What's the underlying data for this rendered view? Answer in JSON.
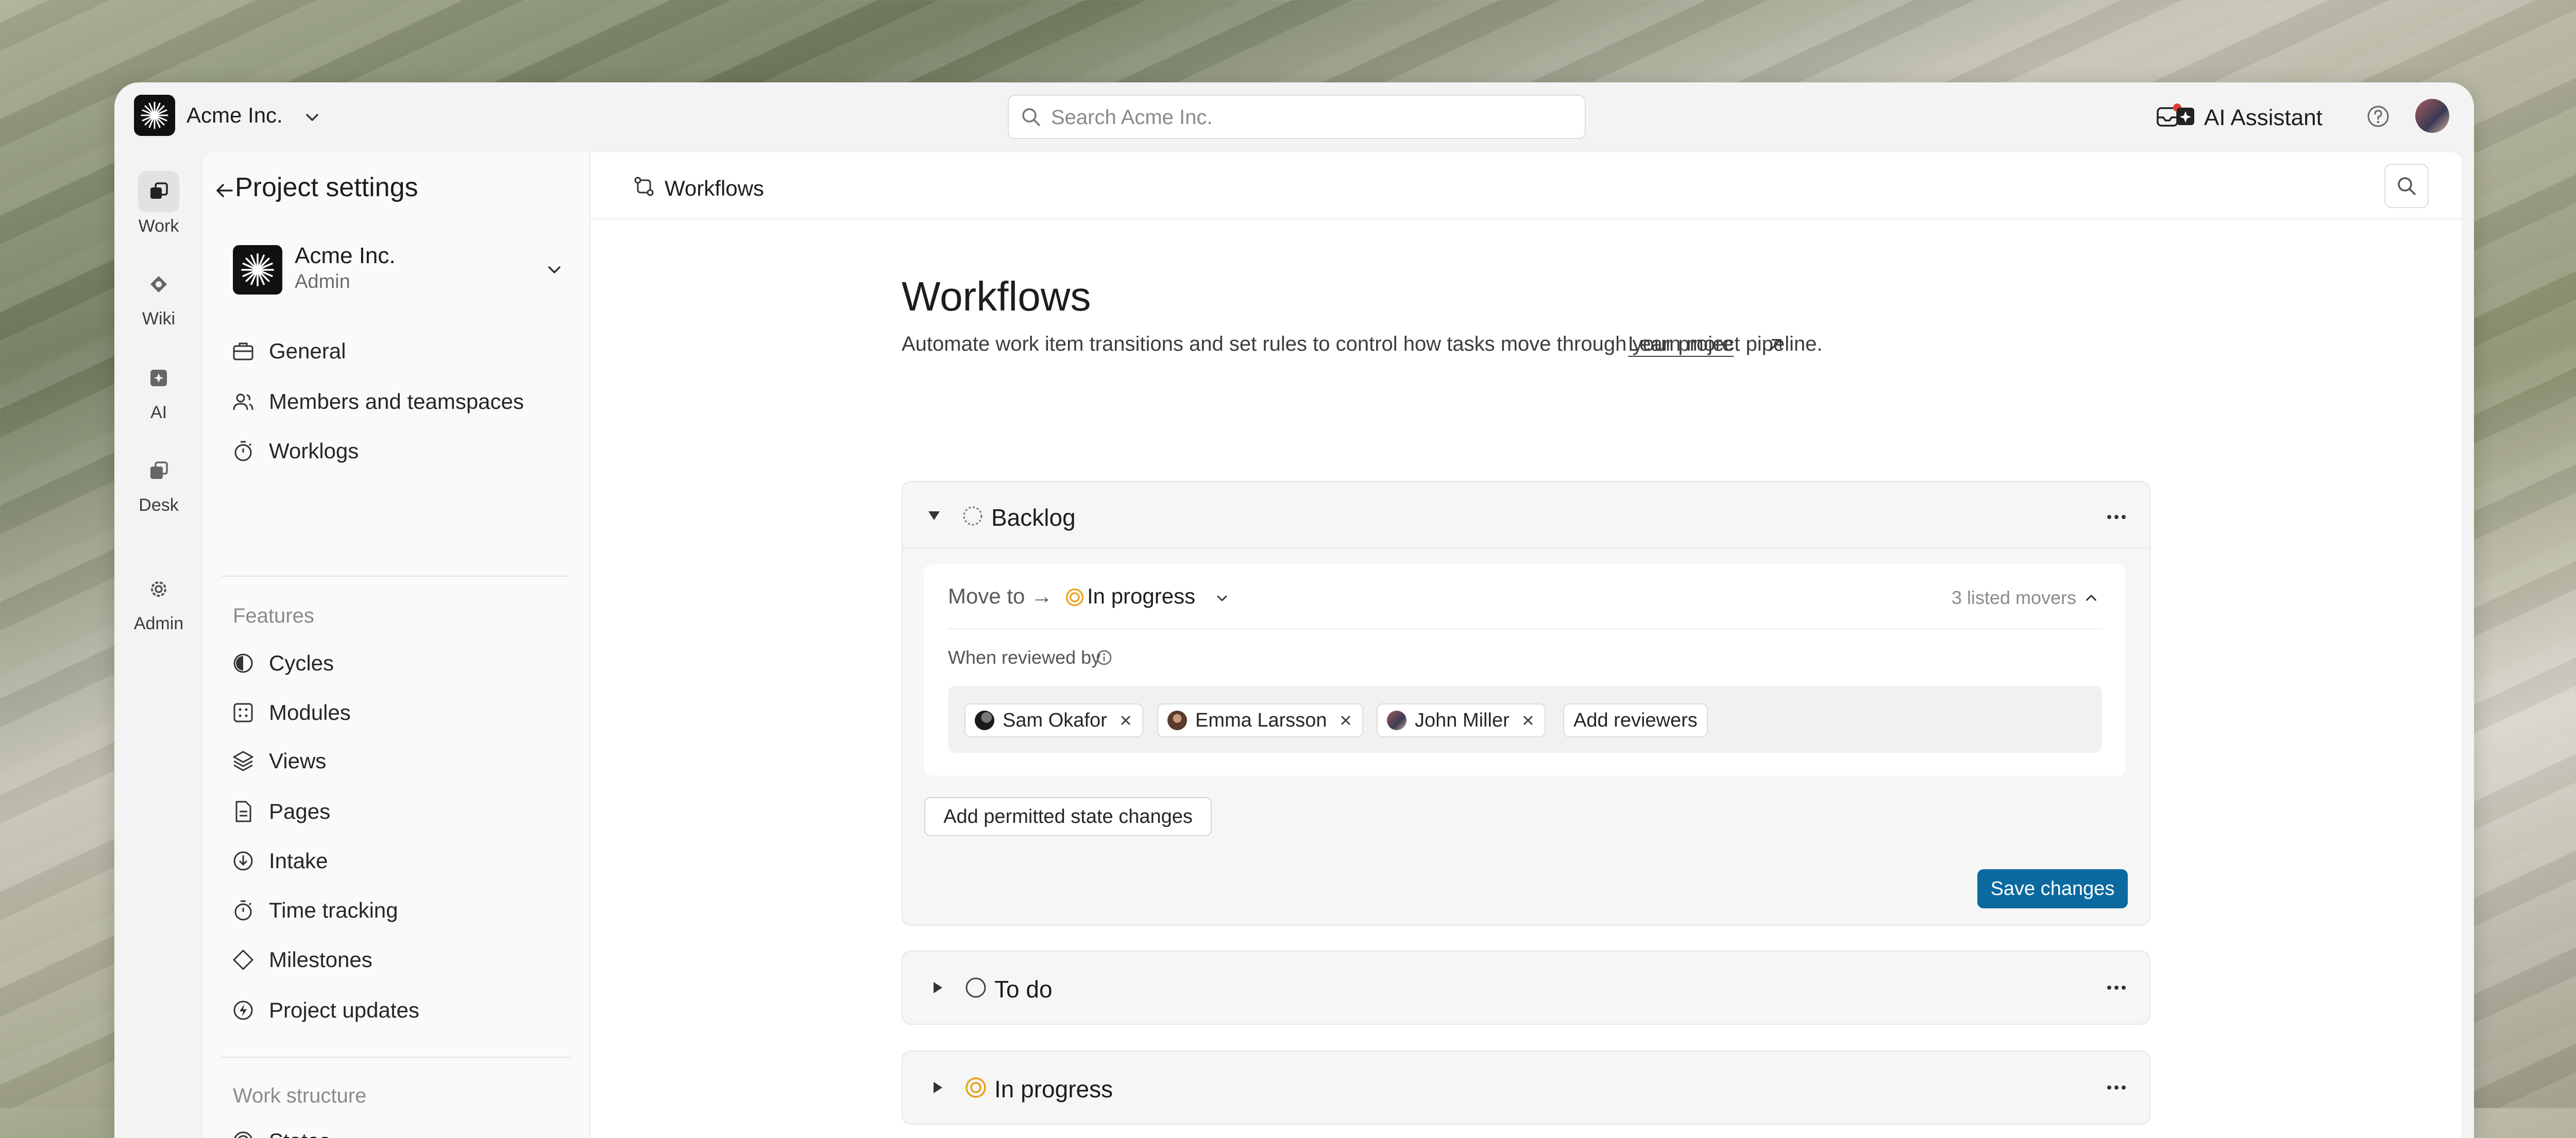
{
  "colors": {
    "accent": "#0a6aa0",
    "in_progress": "#e8a11a",
    "notification": "#e53935"
  },
  "topbar": {
    "workspace_name": "Acme Inc.",
    "search_placeholder": "Search Acme Inc.",
    "ai_assistant_label": "AI Assistant"
  },
  "rail": [
    {
      "label": "Work",
      "icon": "work-icon"
    },
    {
      "label": "Wiki",
      "icon": "wiki-icon"
    },
    {
      "label": "AI",
      "icon": "ai-icon"
    },
    {
      "label": "Desk",
      "icon": "desk-icon"
    },
    {
      "label": "Admin",
      "icon": "gear-icon"
    }
  ],
  "settings": {
    "title": "Project settings",
    "project_name": "Acme Inc.",
    "project_role": "Admin",
    "general_items": [
      {
        "label": "General",
        "icon": "briefcase-icon"
      },
      {
        "label": "Members and teamspaces",
        "icon": "members-icon"
      },
      {
        "label": "Worklogs",
        "icon": "timer-icon"
      }
    ],
    "features_heading": "Features",
    "feature_items": [
      {
        "label": "Cycles",
        "icon": "cycle-icon"
      },
      {
        "label": "Modules",
        "icon": "modules-icon"
      },
      {
        "label": "Views",
        "icon": "layers-icon"
      },
      {
        "label": "Pages",
        "icon": "page-icon"
      },
      {
        "label": "Intake",
        "icon": "intake-icon"
      },
      {
        "label": "Time tracking",
        "icon": "timer-icon"
      },
      {
        "label": "Milestones",
        "icon": "diamond-icon"
      },
      {
        "label": "Project updates",
        "icon": "bolt-icon"
      }
    ],
    "work_structure_heading": "Work structure",
    "work_structure_items": [
      {
        "label": "States",
        "icon": "states-icon"
      }
    ]
  },
  "main": {
    "breadcrumb": "Workflows",
    "title": "Workflows",
    "description": "Automate work item transitions and set rules to control how tasks move through your project pipeline.",
    "learn_more": "Learn more",
    "backlog": {
      "label": "Backlog",
      "move_to_label": "Move to →",
      "move_to_state": "In progress",
      "listed_movers": "3 listed movers",
      "when_reviewed_by": "When reviewed by",
      "reviewers": [
        "Sam Okafor",
        "Emma Larsson",
        "John Miller"
      ],
      "add_reviewers": "Add reviewers",
      "add_permitted": "Add permitted state changes",
      "save": "Save changes"
    },
    "todo": {
      "label": "To do"
    },
    "in_progress": {
      "label": "In progress"
    }
  }
}
